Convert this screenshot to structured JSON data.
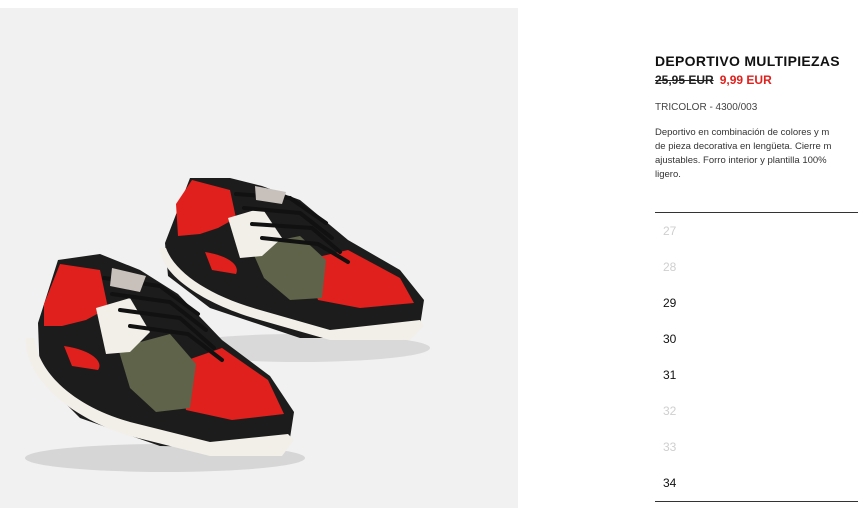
{
  "product": {
    "title": "DEPORTIVO MULTIPIEZAS",
    "old_price": "25,95 EUR",
    "new_price": "9,99 EUR",
    "color_ref": "TRICOLOR - 4300/003",
    "description_lines": [
      "Deportivo en combinación de colores y m",
      "de pieza decorativa en lengüeta. Cierre m",
      "ajustables. Forro interior y plantilla 100%",
      "ligero."
    ]
  },
  "sizes": [
    {
      "label": "27",
      "available": false
    },
    {
      "label": "28",
      "available": false
    },
    {
      "label": "29",
      "available": true
    },
    {
      "label": "30",
      "available": true
    },
    {
      "label": "31",
      "available": true
    },
    {
      "label": "32",
      "available": false
    },
    {
      "label": "33",
      "available": false
    },
    {
      "label": "34",
      "available": true
    }
  ],
  "colors": {
    "sale_red": "#e0201c",
    "shoe_red": "#e0201c",
    "shoe_black": "#1c1c1c",
    "shoe_cream": "#f2efe9",
    "shoe_olive": "#5e6349"
  }
}
